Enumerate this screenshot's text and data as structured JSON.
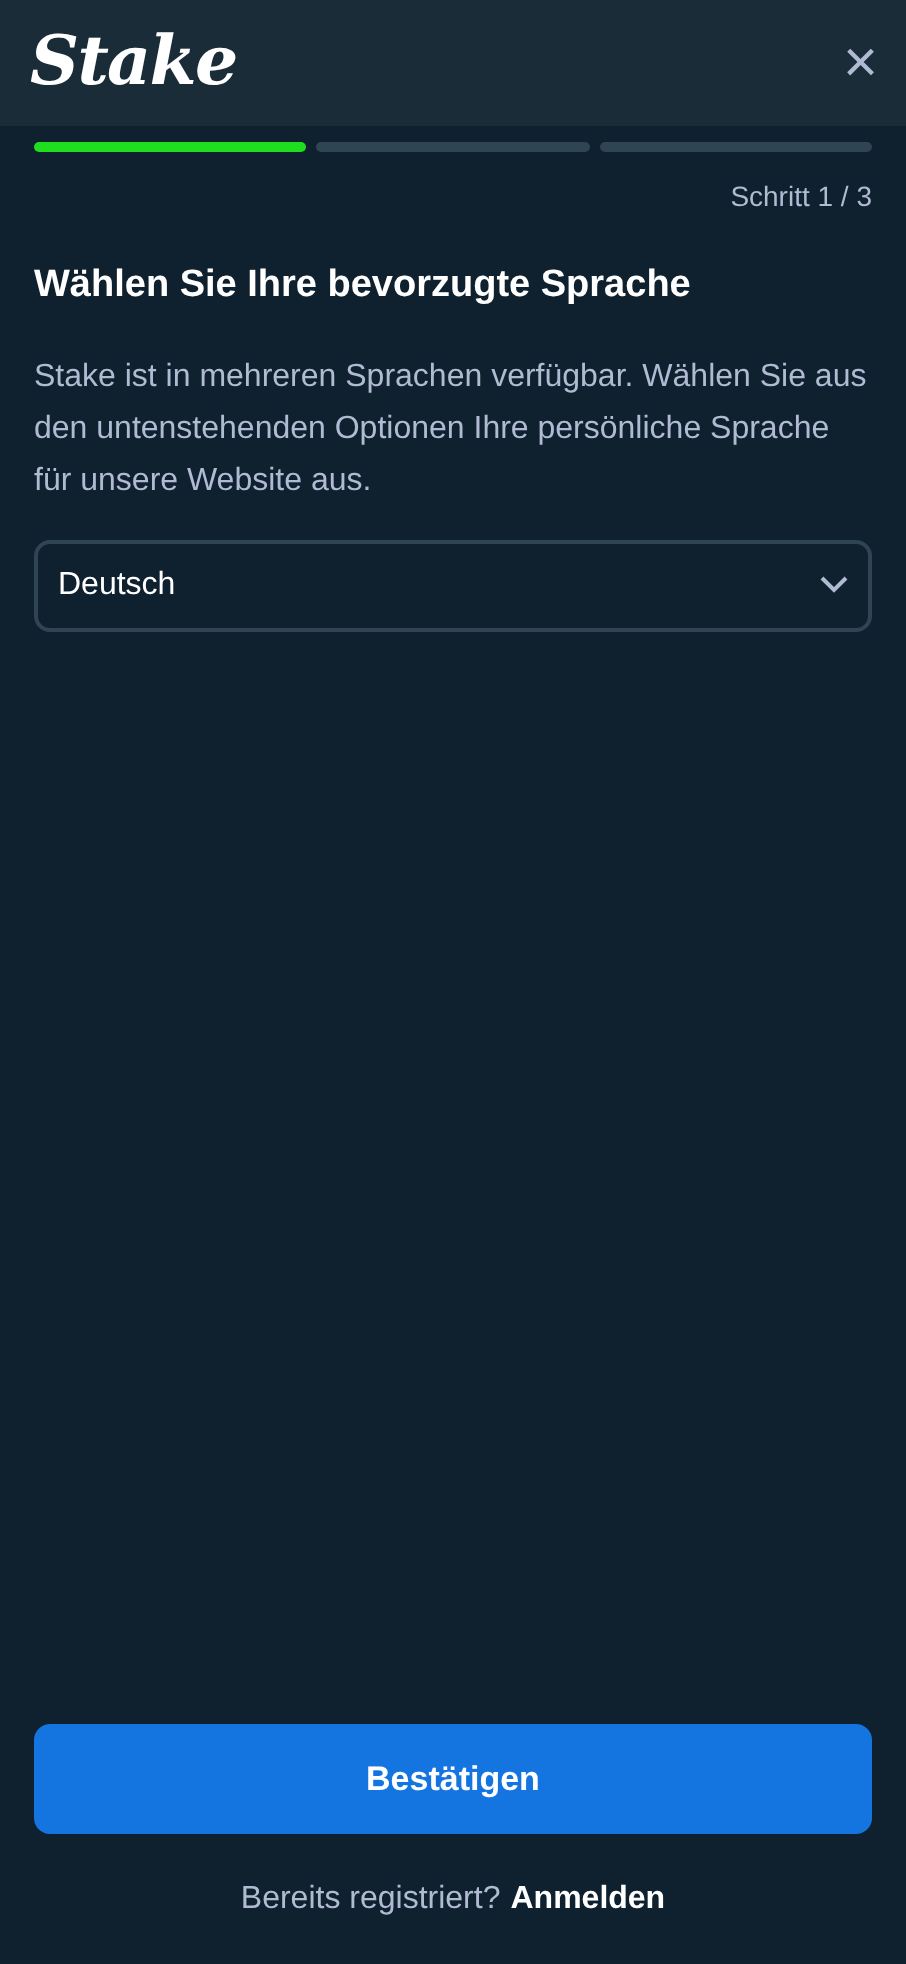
{
  "header": {
    "logo": "Stake",
    "close": "×"
  },
  "progress": {
    "steps": [
      {
        "done": true
      },
      {
        "done": false
      },
      {
        "done": false
      }
    ],
    "label": "Schritt 1 / 3"
  },
  "title": "Wählen Sie Ihre bevorzugte Sprache",
  "description": "Stake ist in mehreren Sprachen verfügbar. Wählen Sie aus den untenstehenden Optionen Ihre persönliche Sprache für unsere Website aus.",
  "language_select": {
    "value": "Deutsch"
  },
  "confirm_button": "Bestätigen",
  "footer": {
    "text": "Bereits registriert?",
    "link": "Anmelden"
  }
}
